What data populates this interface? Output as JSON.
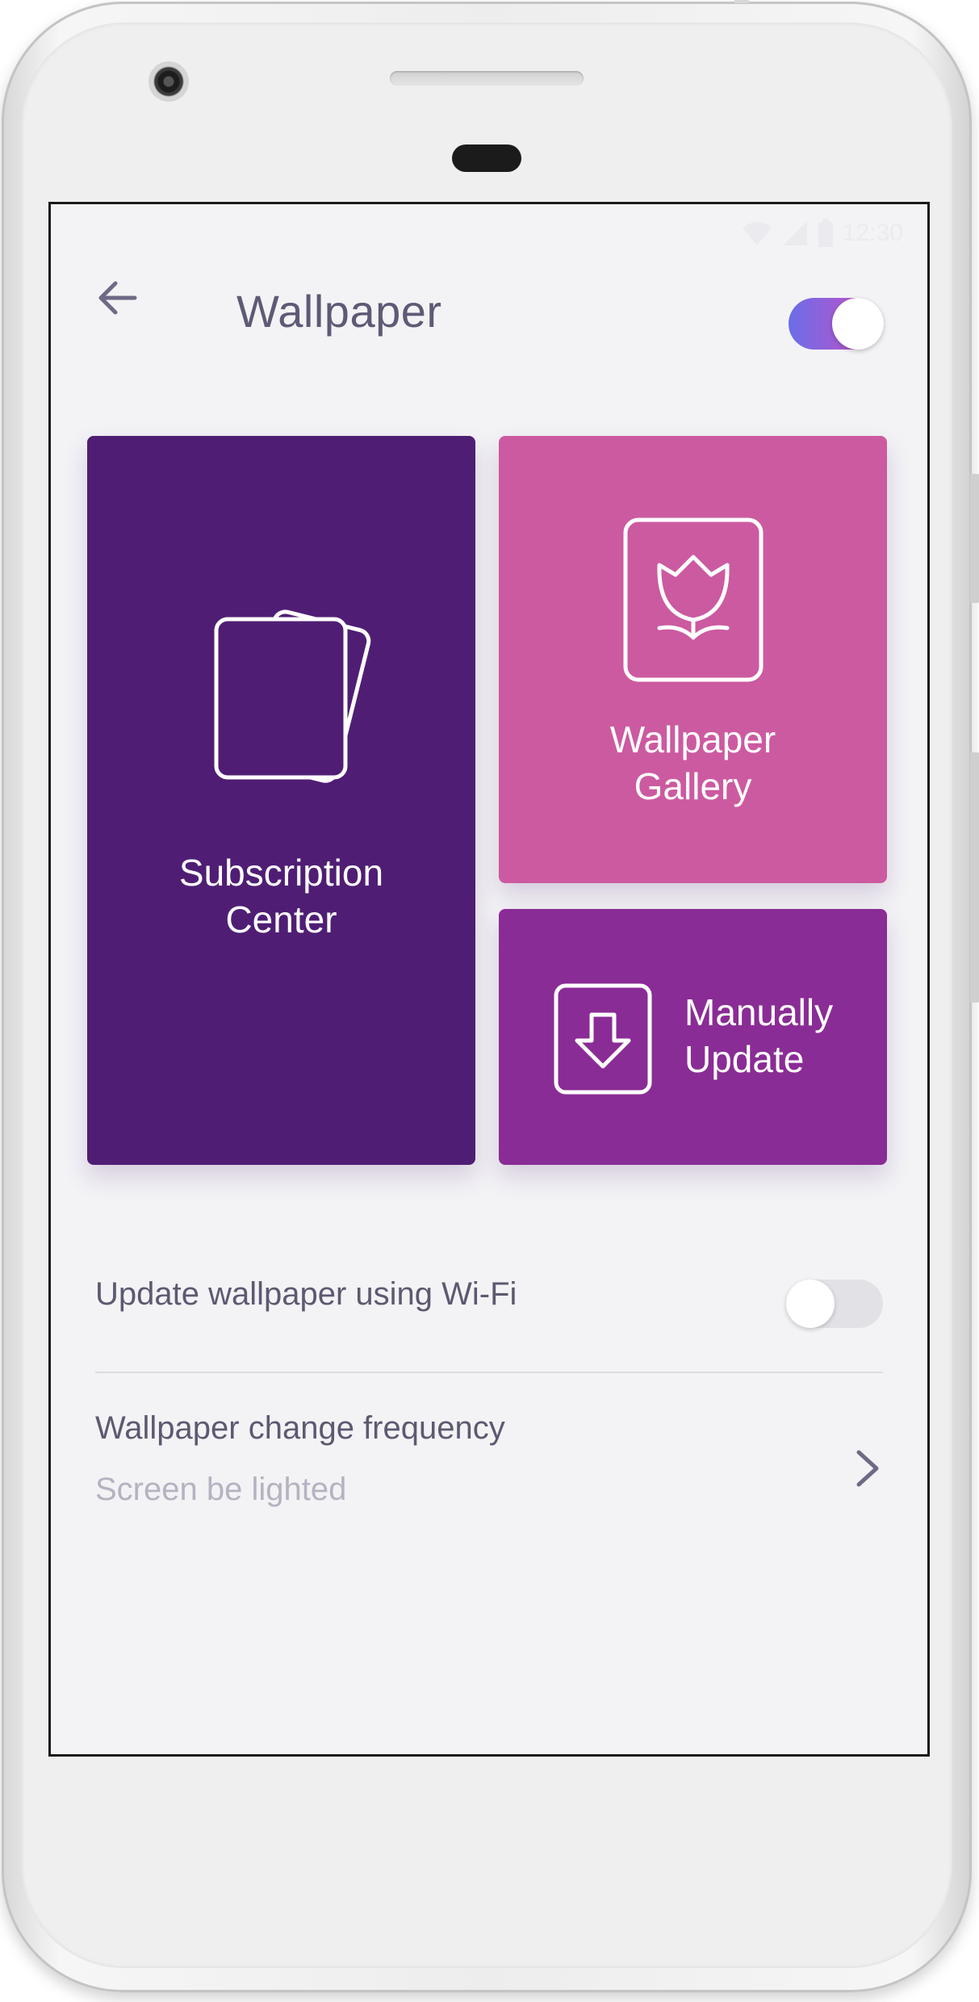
{
  "status_bar": {
    "time": "12:30",
    "icons": [
      "wifi-icon",
      "signal-icon",
      "battery-icon"
    ]
  },
  "header": {
    "back_icon": "arrow-left-icon",
    "title": "Wallpaper",
    "master_toggle_on": true
  },
  "tiles": {
    "subscription": {
      "label_line1": "Subscription",
      "label_line2": "Center",
      "icon": "cards-stack-icon",
      "color": "#4f1e74"
    },
    "gallery": {
      "label_line1": "Wallpaper",
      "label_line2": "Gallery",
      "icon": "flower-frame-icon",
      "color": "#cc5aa0"
    },
    "update": {
      "label_line1": "Manually",
      "label_line2": "Update",
      "icon": "download-arrow-icon",
      "color": "#8a2c95"
    }
  },
  "settings": {
    "wifi_update": {
      "label": "Update wallpaper using Wi-Fi",
      "enabled": false
    },
    "frequency": {
      "label": "Wallpaper change frequency",
      "value": "Screen be lighted",
      "icon": "chevron-right-icon"
    }
  },
  "colors": {
    "background": "#f3f3f6",
    "title_text": "#5d5a75",
    "toggle_gradient_start": "#6a6ee8",
    "toggle_gradient_end": "#d95aa8"
  }
}
